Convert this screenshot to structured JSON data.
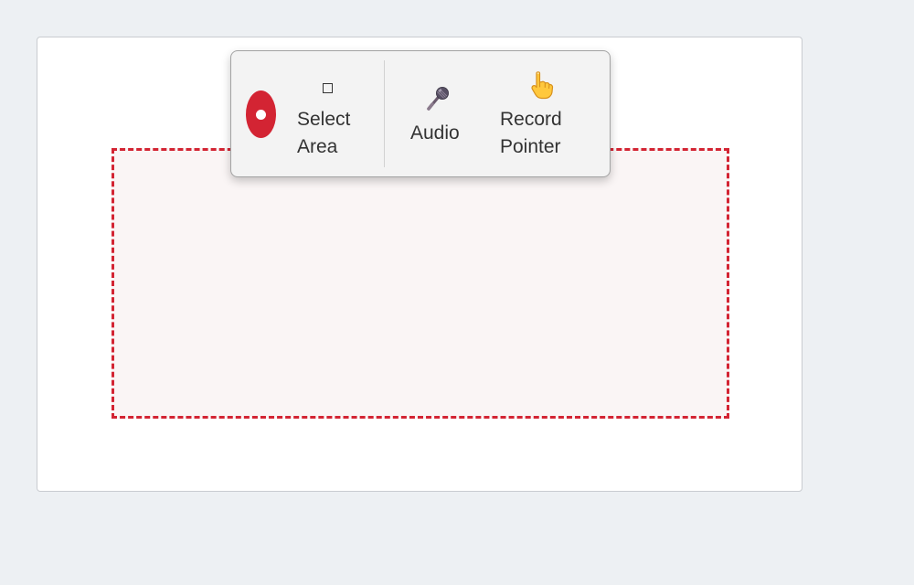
{
  "toolbar": {
    "record_button": {
      "icon": "record-icon",
      "color": "#d32433"
    },
    "tools": [
      {
        "id": "select-area",
        "icon": "square-icon",
        "label": "Select\nArea"
      },
      {
        "id": "audio",
        "icon": "microphone-icon",
        "label": "Audio"
      },
      {
        "id": "record-pointer",
        "icon": "pointing-hand-icon",
        "label": "Record\nPointer"
      }
    ]
  },
  "selection_area": {
    "border_color": "#d32433",
    "fill_color": "#faf5f5"
  },
  "colors": {
    "background": "#edf0f3",
    "window": "#ffffff",
    "toolbar": "#f3f3f3",
    "accent": "#d32433"
  }
}
